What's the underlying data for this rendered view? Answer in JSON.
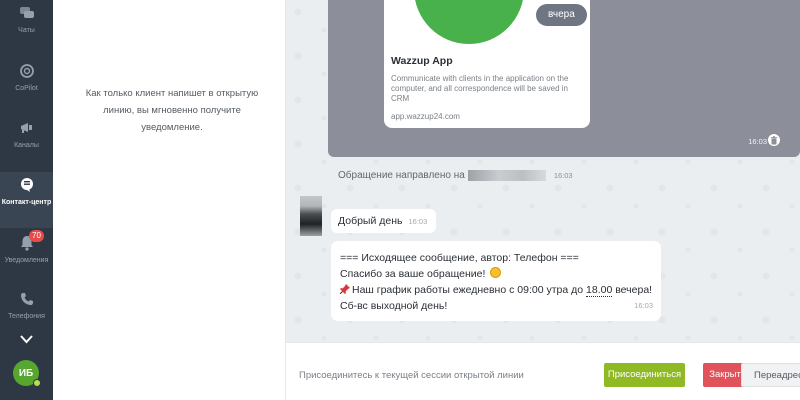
{
  "sidebar": {
    "items": [
      {
        "label": "Чаты",
        "icon": "chat-bubbles-icon"
      },
      {
        "label": "CoPilot",
        "icon": "copilot-icon"
      },
      {
        "label": "Каналы",
        "icon": "megaphone-icon"
      },
      {
        "label": "Контакт-центр",
        "icon": "contact-center-icon"
      },
      {
        "label": "Уведомления",
        "icon": "bell-icon",
        "badge": "70"
      },
      {
        "label": "Телефония",
        "icon": "phone-icon"
      }
    ],
    "avatar_initials": "ИБ"
  },
  "empty_panel": {
    "text": "Как только клиент напишет в открытую линию, вы мгновенно получите уведомление."
  },
  "chat": {
    "day_label": "вчера",
    "outgoing": {
      "card_title": "Wazzup App",
      "card_description": "Communicate with clients in the application on the computer, and all correspondence will be saved in CRM",
      "card_domain": "app.wazzup24.com",
      "time": "16:03"
    },
    "system_message": {
      "text": "Обращение направлено на",
      "time": "16:03"
    },
    "incoming": [
      {
        "text": "Добрый день",
        "time": "16:03"
      },
      {
        "line1": "=== Исходящее сообщение, автор: Телефон ===",
        "line2": "Спасибо за ваше обращение!",
        "line3_pre": "Наш график работы ежедневно с 09:00 утра до ",
        "line3_underlined": "18.00",
        "line3_post": " вечера!",
        "line4": "Сб-вс выходной день!",
        "time": "16:03"
      }
    ]
  },
  "bottom_bar": {
    "prompt": "Присоединитесь к текущей сессии открытой линии",
    "join_label": "Присоединиться",
    "close_label": "Закрыть",
    "redirect_label": "Переадресовать"
  }
}
